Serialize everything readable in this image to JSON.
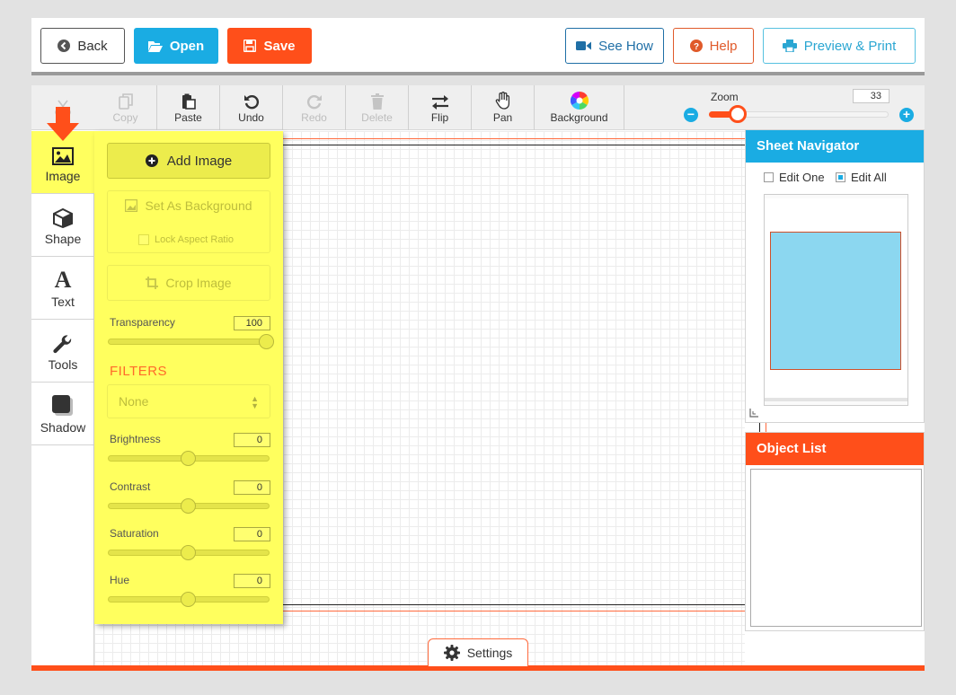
{
  "topbar": {
    "back_label": "Back",
    "open_label": "Open",
    "save_label": "Save",
    "see_how_label": "See How",
    "help_label": "Help",
    "preview_label": "Preview & Print"
  },
  "toolbar": {
    "copy_label": "Copy",
    "paste_label": "Paste",
    "undo_label": "Undo",
    "redo_label": "Redo",
    "delete_label": "Delete",
    "flip_label": "Flip",
    "pan_label": "Pan",
    "background_label": "Background",
    "zoom_label": "Zoom",
    "zoom_value": "33",
    "zoom_fraction": 0.16
  },
  "leftnav": {
    "items": [
      {
        "label": "Image"
      },
      {
        "label": "Shape"
      },
      {
        "label": "Text"
      },
      {
        "label": "Tools"
      },
      {
        "label": "Shadow"
      }
    ]
  },
  "image_panel": {
    "add_image_label": "Add Image",
    "set_background_label": "Set As Background",
    "lock_aspect_label": "Lock Aspect Ratio",
    "crop_label": "Crop Image",
    "transparency_label": "Transparency",
    "transparency_value": "100",
    "transparency_fraction": 1.0,
    "filters_title": "FILTERS",
    "filter_selected": "None",
    "brightness_label": "Brightness",
    "brightness_value": "0",
    "contrast_label": "Contrast",
    "contrast_value": "0",
    "saturation_label": "Saturation",
    "saturation_value": "0",
    "hue_label": "Hue",
    "hue_value": "0",
    "adjust_fraction": 0.5
  },
  "sheet_navigator": {
    "title": "Sheet Navigator",
    "edit_one_label": "Edit One",
    "edit_all_label": "Edit All"
  },
  "object_list": {
    "title": "Object List"
  },
  "settings": {
    "label": "Settings"
  },
  "colors": {
    "accent_blue": "#1aace3",
    "accent_orange": "#ff4f1a",
    "panel_yellow": "#ffff5e"
  }
}
